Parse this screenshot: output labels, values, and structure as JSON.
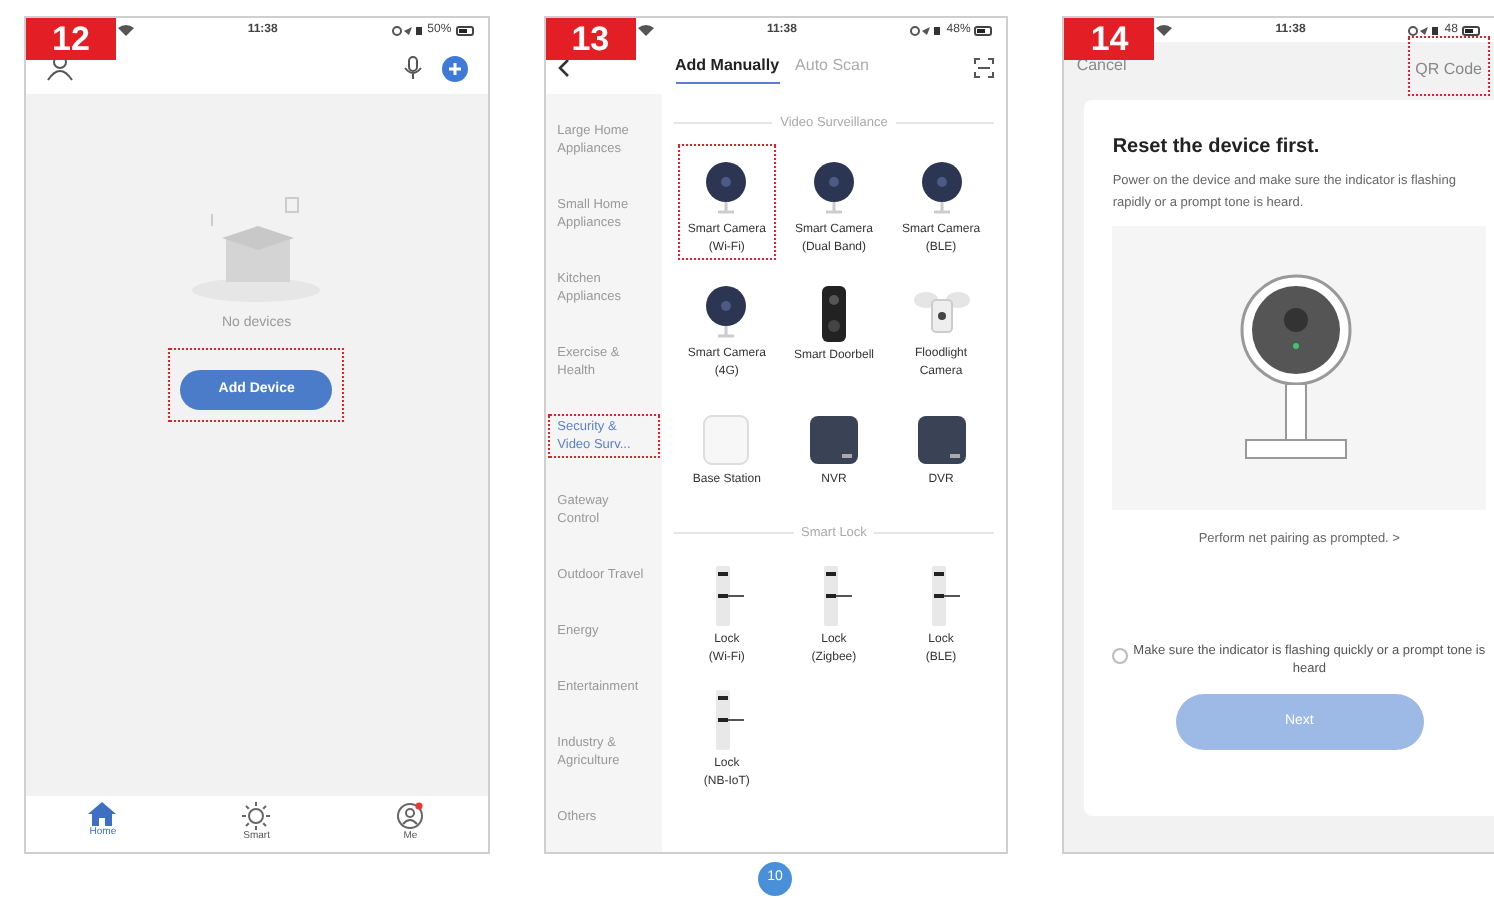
{
  "screens": [
    {
      "kind": "home",
      "step": "12",
      "time": "11:38",
      "battery": "50%",
      "empty_text": "No devices",
      "add_button": {
        "label": "Add Device",
        "highlighted": true
      },
      "tabs": [
        {
          "label": "Home",
          "selected": true
        },
        {
          "label": "Smart",
          "selected": false
        },
        {
          "label": "Me",
          "selected": false
        }
      ]
    },
    {
      "kind": "category",
      "step": "13",
      "time": "11:38",
      "battery": "48%",
      "tabs": [
        {
          "label": "Add Manually",
          "selected": true
        },
        {
          "label": "Auto Scan",
          "selected": false
        }
      ],
      "categories": [
        {
          "label": "Large Home Appliances",
          "selected": false,
          "highlighted": false
        },
        {
          "label": "Small Home Appliances",
          "selected": false,
          "highlighted": false
        },
        {
          "label": "Kitchen Appliances",
          "selected": false,
          "highlighted": false
        },
        {
          "label": "Exercise & Health",
          "selected": false,
          "highlighted": false
        },
        {
          "label": "Security & Video Surv...",
          "selected": true,
          "highlighted": true
        },
        {
          "label": "Gateway Control",
          "selected": false,
          "highlighted": false
        },
        {
          "label": "Outdoor Travel",
          "selected": false,
          "highlighted": false
        },
        {
          "label": "Energy",
          "selected": false,
          "highlighted": false
        },
        {
          "label": "Entertainment",
          "selected": false,
          "highlighted": false
        },
        {
          "label": "Industry & Agriculture",
          "selected": false,
          "highlighted": false
        },
        {
          "label": "Others",
          "selected": false,
          "highlighted": false
        }
      ],
      "sections": [
        {
          "title": "Video Surveillance",
          "devices": [
            {
              "kind": "camera",
              "label": "Smart Camera\n(Wi-Fi)",
              "highlighted": true
            },
            {
              "kind": "camera",
              "label": "Smart Camera\n(Dual Band)",
              "highlighted": false
            },
            {
              "kind": "camera",
              "label": "Smart Camera\n(BLE)",
              "highlighted": false
            },
            {
              "kind": "camera",
              "label": "Smart Camera\n(4G)",
              "highlighted": false
            },
            {
              "kind": "doorbell",
              "label": "Smart Doorbell",
              "highlighted": false
            },
            {
              "kind": "floodlight",
              "label": "Floodlight\nCamera",
              "highlighted": false
            },
            {
              "kind": "base",
              "label": "Base Station",
              "highlighted": false
            },
            {
              "kind": "recorder",
              "label": "NVR",
              "highlighted": false
            },
            {
              "kind": "recorder",
              "label": "DVR",
              "highlighted": false
            }
          ]
        },
        {
          "title": "Smart Lock",
          "devices": [
            {
              "kind": "lock",
              "label": "Lock\n(Wi-Fi)",
              "highlighted": false
            },
            {
              "kind": "lock",
              "label": "Lock\n(Zigbee)",
              "highlighted": false
            },
            {
              "kind": "lock",
              "label": "Lock\n(BLE)",
              "highlighted": false
            },
            {
              "kind": "lock",
              "label": "Lock\n(NB-IoT)",
              "highlighted": false
            }
          ]
        }
      ]
    },
    {
      "kind": "reset",
      "step": "14",
      "time": "11:38",
      "battery": "48",
      "cancel": "Cancel",
      "qr_button": {
        "label": "QR Code",
        "highlighted": true
      },
      "title": "Reset the device first.",
      "description": "Power on the device and make sure the indicator is flashing rapidly or a prompt tone is heard.",
      "link": "Perform net pairing as prompted. >",
      "confirm": {
        "label": "Make sure the indicator is flashing quickly or a prompt tone is heard",
        "checked": false
      },
      "next": {
        "label": "Next",
        "disabled": true
      }
    }
  ],
  "page_number": "10"
}
